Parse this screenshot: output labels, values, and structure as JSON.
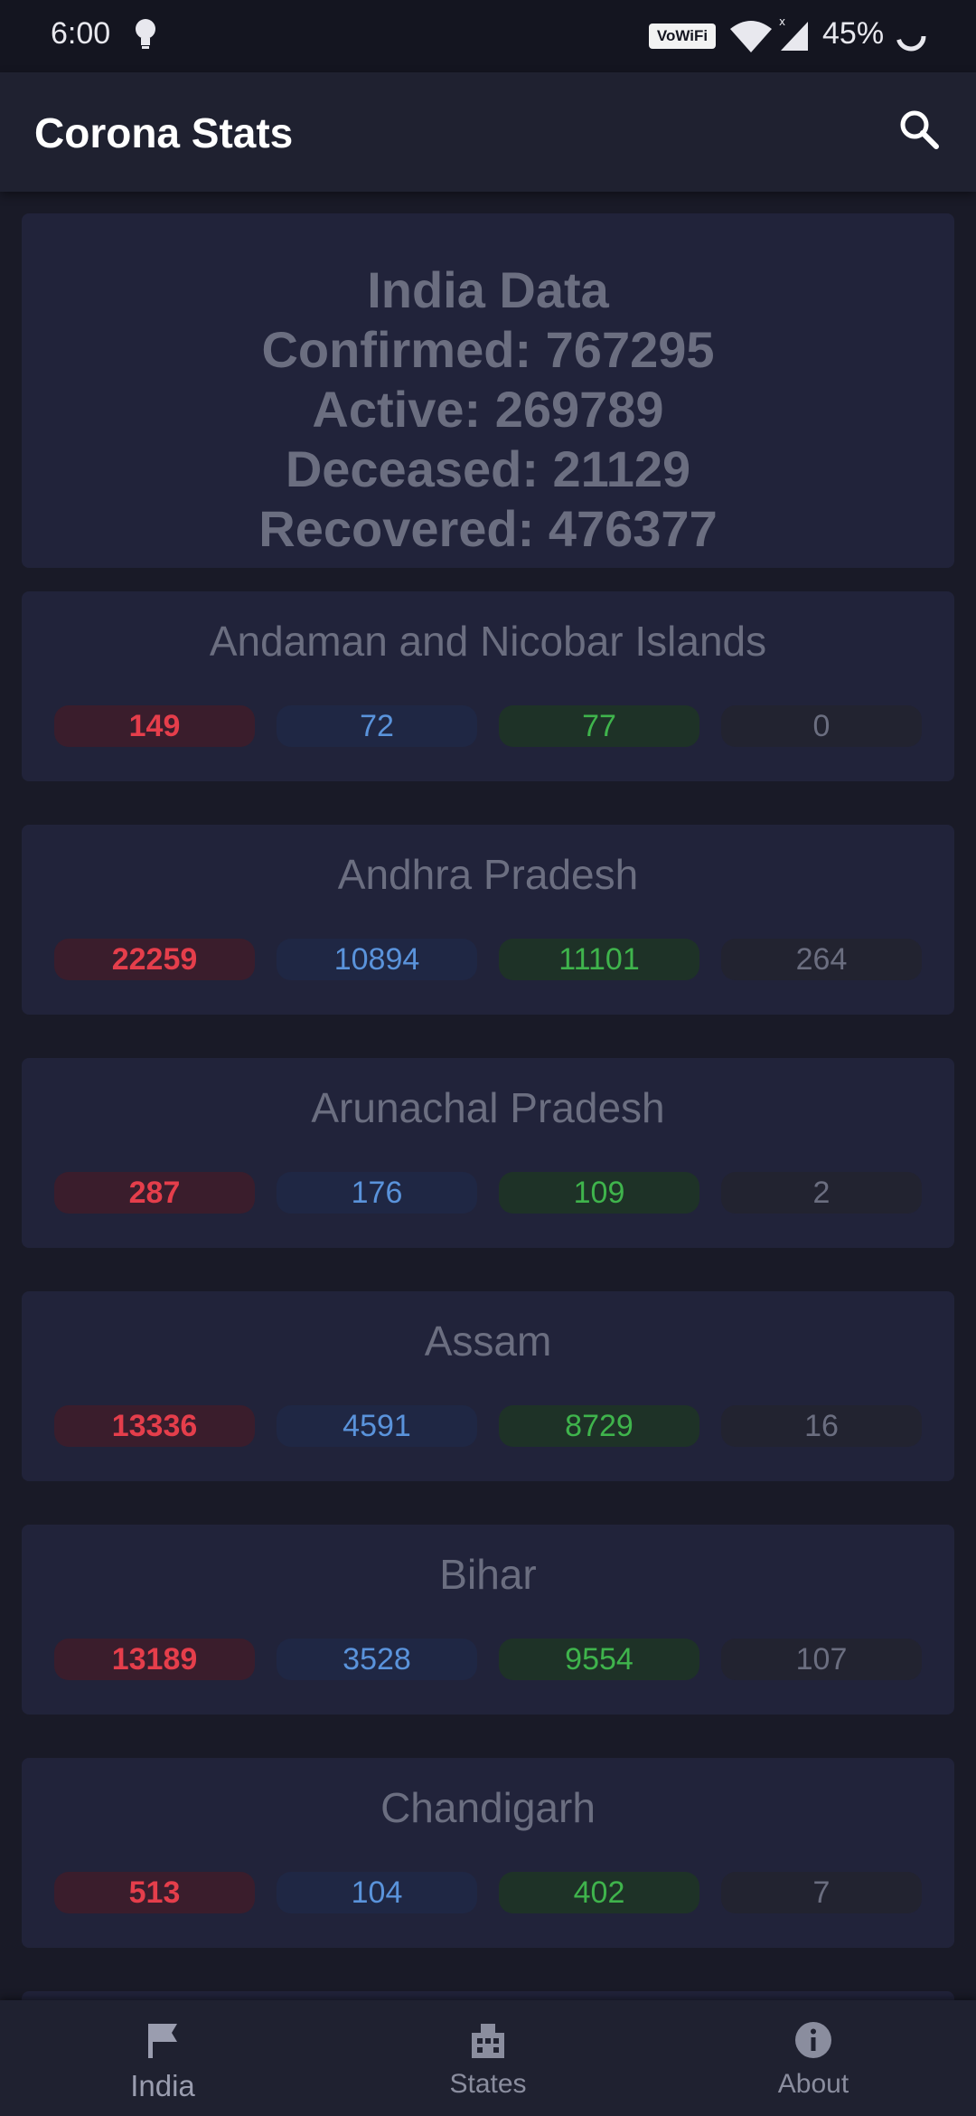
{
  "status_bar": {
    "time": "6:00",
    "vowifi": "VoWiFi",
    "battery": "45%"
  },
  "app_bar": {
    "title": "Corona Stats"
  },
  "summary": {
    "heading": "India Data",
    "confirmed": "Confirmed: 767295",
    "active": "Active: 269789",
    "deceased": "Deceased: 21129",
    "recovered": "Recovered: 476377"
  },
  "states": [
    {
      "name": "Andaman and Nicobar Islands",
      "confirmed": "149",
      "active": "72",
      "recovered": "77",
      "deceased": "0"
    },
    {
      "name": "Andhra Pradesh",
      "confirmed": "22259",
      "active": "10894",
      "recovered": "11101",
      "deceased": "264"
    },
    {
      "name": "Arunachal Pradesh",
      "confirmed": "287",
      "active": "176",
      "recovered": "109",
      "deceased": "2"
    },
    {
      "name": "Assam",
      "confirmed": "13336",
      "active": "4591",
      "recovered": "8729",
      "deceased": "16"
    },
    {
      "name": "Bihar",
      "confirmed": "13189",
      "active": "3528",
      "recovered": "9554",
      "deceased": "107"
    },
    {
      "name": "Chandigarh",
      "confirmed": "513",
      "active": "104",
      "recovered": "402",
      "deceased": "7"
    }
  ],
  "bottom_nav": [
    {
      "label": "India",
      "icon": "flag-icon"
    },
    {
      "label": "States",
      "icon": "building-icon"
    },
    {
      "label": "About",
      "icon": "info-icon"
    }
  ],
  "colors": {
    "background": "#191a27",
    "card": "#21233a",
    "confirmed": "#e53e4b",
    "active": "#5a93db",
    "recovered": "#3fb44c",
    "deceased": "#6b6e80"
  }
}
